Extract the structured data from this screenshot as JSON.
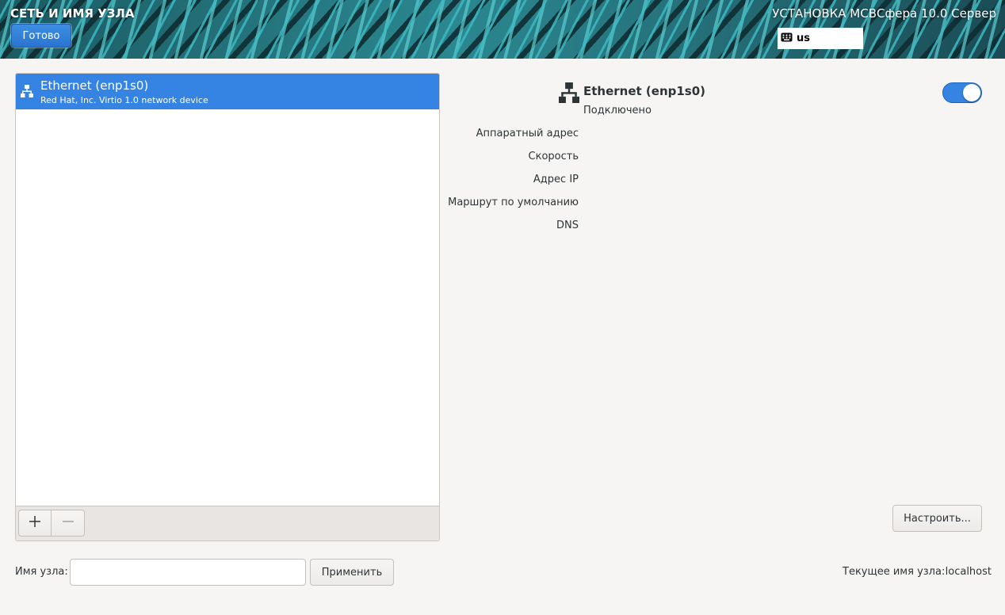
{
  "header": {
    "page_title": "СЕТЬ И ИМЯ УЗЛА",
    "done_label": "Готово",
    "product_title": "УСТАНОВКА МСВСфера 10.0 Сервер",
    "keyboard_layout": "us",
    "keyboard_icon": "keyboard-icon"
  },
  "devices": {
    "items": [
      {
        "name": "Ethernet (enp1s0)",
        "description": "Red Hat, Inc. Virtio 1.0 network device",
        "icon": "network-wired-icon",
        "selected": true
      }
    ],
    "toolbar": {
      "add_icon": "plus-icon",
      "remove_icon": "minus-icon"
    }
  },
  "details": {
    "icon": "network-wired-icon",
    "title": "Ethernet (enp1s0)",
    "status": "Подключено",
    "enabled": true,
    "labels": {
      "hw_address": "Аппаратный адрес",
      "speed": "Скорость",
      "ip_address": "Адрес IP",
      "default_route": "Маршрут по умолчанию",
      "dns": "DNS"
    },
    "configure_label": "Настроить..."
  },
  "hostname": {
    "label": "Имя узла:",
    "value": "",
    "placeholder": "",
    "apply_label": "Применить",
    "current_label": "Текущее имя узла:",
    "current_value": "localhost"
  },
  "colors": {
    "accent": "#3584e4",
    "background": "#f6f5f4"
  }
}
